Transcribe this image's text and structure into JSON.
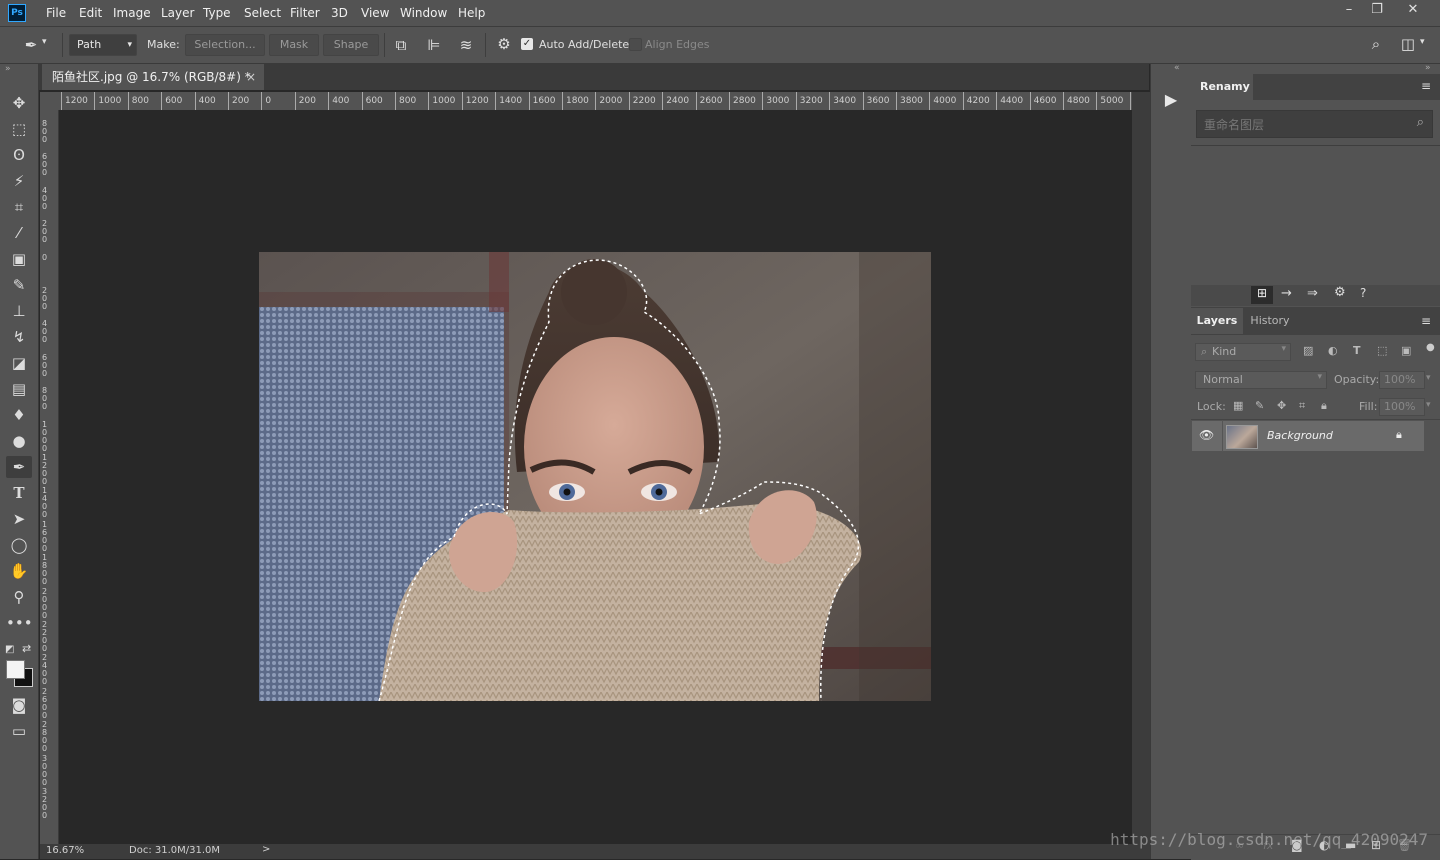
{
  "app": {
    "logo": "Ps"
  },
  "menu": [
    "File",
    "Edit",
    "Image",
    "Layer",
    "Type",
    "Select",
    "Filter",
    "3D",
    "View",
    "Window",
    "Help"
  ],
  "window_controls": {
    "minimize": "–",
    "restore": "❐",
    "close": "✕"
  },
  "options": {
    "mode_value": "Path",
    "make_label": "Make:",
    "selection_label": "Selection...",
    "mask_label": "Mask",
    "shape_label": "Shape",
    "auto_add_delete": "Auto Add/Delete",
    "auto_add_delete_checked": true,
    "align_edges": "Align Edges"
  },
  "document": {
    "tab_title": "陌鱼社区.jpg @ 16.7% (RGB/8#) *",
    "close": "×"
  },
  "ruler": {
    "h_labels": [
      "1200",
      "1000",
      "800",
      "600",
      "400",
      "200",
      "0",
      "200",
      "400",
      "600",
      "800",
      "1000",
      "1200",
      "1400",
      "1600",
      "1800",
      "2000",
      "2200",
      "2400",
      "2600",
      "2800",
      "3000",
      "3200",
      "3400",
      "3600",
      "3800",
      "4000",
      "4200",
      "4400",
      "4600",
      "4800",
      "5000",
      "5"
    ],
    "v_labels": [
      "8 0 0",
      "6 0 0",
      "4 0 0",
      "2 0 0",
      "0",
      "2 0 0",
      "4 0 0",
      "6 0 0",
      "8 0 0",
      "1 0 0 0",
      "1 2 0 0",
      "1 4 0 0",
      "1 6 0 0",
      "1 8 0 0",
      "2 0 0 0",
      "2 2 0 0",
      "2 4 0 0",
      "2 6 0 0",
      "2 8 0 0",
      "3 0 0 0",
      "3 2 0 0"
    ]
  },
  "status": {
    "zoom": "16.67%",
    "doc": "Doc: 31.0M/31.0M",
    "arrow": ">"
  },
  "renamy": {
    "title": "Renamy",
    "search_placeholder": "重命名图层"
  },
  "layers_panel": {
    "tabs": [
      "Layers",
      "History"
    ],
    "kind_label": "Kind",
    "blend_mode": "Normal",
    "opacity_label": "Opacity:",
    "opacity_value": "100%",
    "lock_label": "Lock:",
    "fill_label": "Fill:",
    "fill_value": "100%",
    "layers": [
      {
        "name": "Background",
        "visible": true,
        "locked": true
      }
    ]
  },
  "watermark": "https://blog.csdn.net/qq_42090247"
}
